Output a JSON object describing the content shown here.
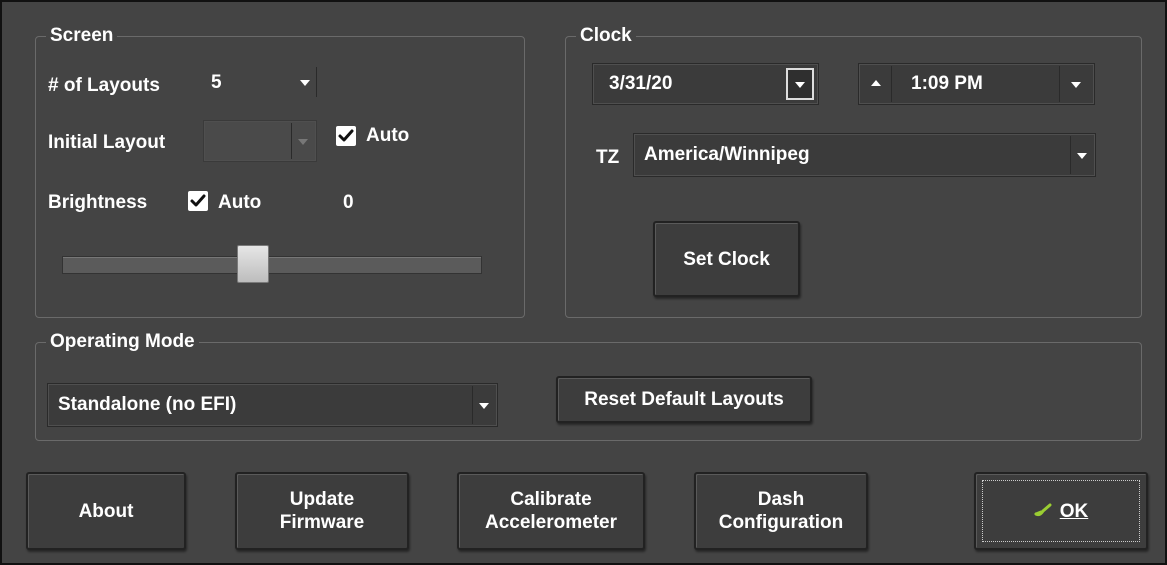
{
  "colors": {
    "window_bg": "#444444",
    "group_border": "#6a6a6a",
    "text": "#ffffff",
    "button_bg": "#3d3d3d",
    "ok_icon": "#9acd32"
  },
  "screen": {
    "title": "Screen",
    "layouts_label": "# of Layouts",
    "layouts_value": "5",
    "initial_layout_label": "Initial Layout",
    "initial_layout_value": "",
    "initial_auto_label": "Auto",
    "initial_auto_checked": true,
    "brightness_label": "Brightness",
    "brightness_auto_label": "Auto",
    "brightness_auto_checked": true,
    "brightness_value": "0",
    "brightness_slider_fraction": 0.45
  },
  "clock": {
    "title": "Clock",
    "date_value": "3/31/20",
    "time_value": "1:09 PM",
    "tz_label": "TZ",
    "tz_value": "America/Winnipeg",
    "set_clock_label": "Set Clock"
  },
  "operating_mode": {
    "title": "Operating Mode",
    "mode_value": "Standalone (no EFI)",
    "reset_label": "Reset Default Layouts"
  },
  "footer": {
    "about_label": "About",
    "update_firmware_label": "Update\nFirmware",
    "calibrate_label": "Calibrate\nAccelerometer",
    "dash_config_label": "Dash\nConfiguration",
    "ok_label": "OK",
    "ok_icon": "check-arrow-icon"
  }
}
